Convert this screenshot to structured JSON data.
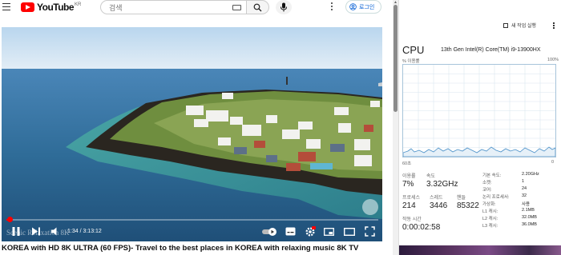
{
  "youtube": {
    "logo_text": "YouTube",
    "logo_region": "KR",
    "search": {
      "placeholder": "검색",
      "value": ""
    },
    "login_label": "로그인",
    "video": {
      "watermark": "Scenic Relaxation 8K",
      "current_time": "1:34",
      "duration": "3:13:12",
      "time_display": "1:34 / 3:13:12",
      "progress": 0.008,
      "title": "KOREA with HD 8K ULTRA (60 FPS)- Travel to the best places in KOREA with relaxing music 8K TV"
    },
    "colors": {
      "brand_red": "#FF0000",
      "link_blue": "#065FD4"
    }
  },
  "task_manager": {
    "new_task_label": "새 작업 실행",
    "section_title": "CPU",
    "cpu_model": "13th Gen Intel(R) Core(TM) i9-13900HX",
    "utilization_label": "% 이용률",
    "utilization_max": "100%",
    "graph_time_label": "60초",
    "graph_min": "0",
    "stats": {
      "utilization_label": "이용률",
      "utilization_value": "7%",
      "speed_label": "속도",
      "speed_value": "3.32GHz",
      "processes_label": "프로세스",
      "processes_value": "214",
      "threads_label": "스레드",
      "threads_value": "3446",
      "handles_label": "핸들",
      "handles_value": "85322",
      "uptime_label": "작동 시간",
      "uptime_value": "0:00:02:58"
    },
    "details": [
      {
        "key": "기본 속도:",
        "value": "2.20GHz"
      },
      {
        "key": "소켓:",
        "value": "1"
      },
      {
        "key": "코어:",
        "value": "24"
      },
      {
        "key": "논리 프로세서:",
        "value": "32"
      },
      {
        "key": "가상화:",
        "value": "사용"
      },
      {
        "key": "L1 캐시:",
        "value": "2.1MB"
      },
      {
        "key": "L2 캐시:",
        "value": "32.0MB"
      },
      {
        "key": "L3 캐시:",
        "value": "36.0MB"
      }
    ],
    "colors": {
      "graph_line": "#4A90C8",
      "graph_fill": "#E6F0F8",
      "graph_border": "#A7C4DA"
    }
  }
}
